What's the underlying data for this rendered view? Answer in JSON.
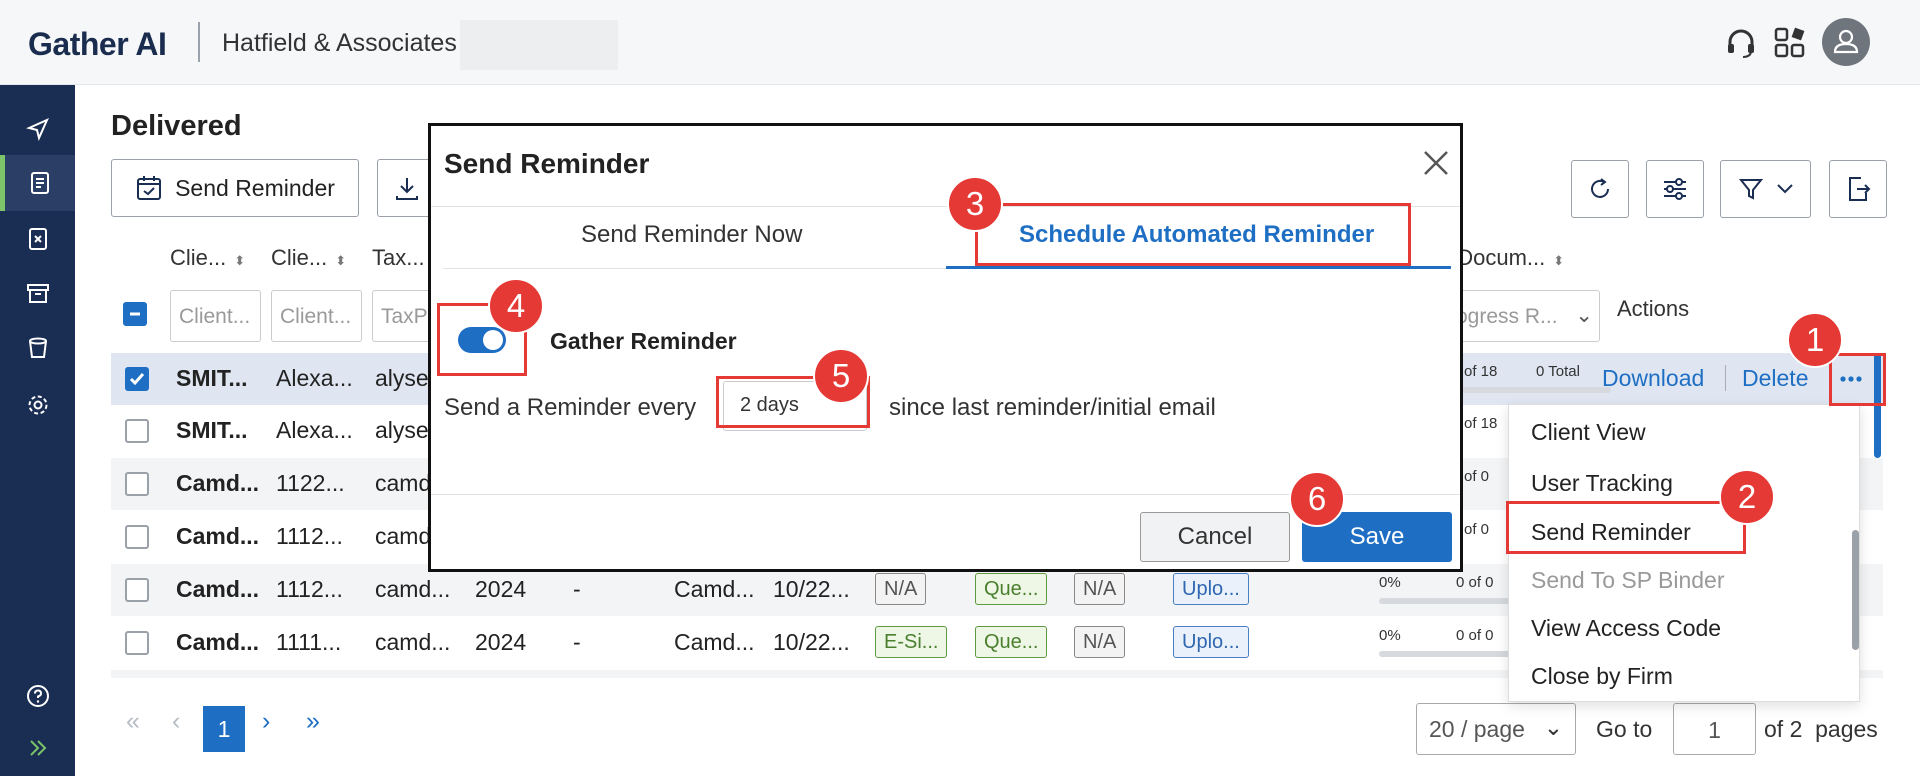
{
  "header": {
    "logo": "Gather AI",
    "firm": "Hatfield & Associates",
    "icons": [
      "headset-icon",
      "apps-icon",
      "user-avatar-icon"
    ]
  },
  "sidebar": {
    "items": [
      "send-icon",
      "document-icon",
      "close-file-icon",
      "archive-icon",
      "trash-icon",
      "settings-icon"
    ],
    "bottom": [
      "help-icon",
      "expand-icon"
    ]
  },
  "page": {
    "title": "Delivered",
    "send_reminder_label": "Send Reminder"
  },
  "table": {
    "headers": [
      "Clie...",
      "Clie...",
      "Tax...",
      "t Docum..."
    ],
    "actions_header": "Actions",
    "filters": [
      "Client...",
      "Client...",
      "TaxP",
      "rogress R..."
    ],
    "rows": [
      {
        "name": "SMIT...",
        "client": "Alexa...",
        "tax": "alyse",
        "progress": "of 18",
        "total": "0 Total",
        "download": "Download",
        "delete": "Delete"
      },
      {
        "name": "SMIT...",
        "client": "Alexa...",
        "tax": "alyse",
        "progress": "of 18"
      },
      {
        "name": "Camd...",
        "client": "1122...",
        "tax": "camd",
        "progress": "of 0"
      },
      {
        "name": "Camd...",
        "client": "1112...",
        "tax": "camd",
        "progress": "of 0"
      },
      {
        "name": "Camd...",
        "client": "1112...",
        "tax": "camd...",
        "year": "2024",
        "dash": "-",
        "col6": "Camd...",
        "date": "10/22...",
        "t1": "N/A",
        "t2": "Que...",
        "t3": "N/A",
        "t4": "Uplo...",
        "pct": "0%",
        "progress": "0 of 0"
      },
      {
        "name": "Camd...",
        "client": "1111...",
        "tax": "camd...",
        "year": "2024",
        "dash": "-",
        "col6": "Camd...",
        "date": "10/22...",
        "t1": "E-Si...",
        "t2": "Que...",
        "t3": "N/A",
        "t4": "Uplo...",
        "pct": "0%",
        "progress": "0 of 0"
      }
    ]
  },
  "menu": {
    "items": [
      "Client View",
      "User Tracking",
      "Send Reminder",
      "Send To SP Binder",
      "View Access Code",
      "Close by Firm"
    ]
  },
  "pagination": {
    "current": "1",
    "per_page": "20 / page",
    "goto_label": "Go to",
    "goto_value": "1",
    "of_pages": "of 2  pages"
  },
  "modal": {
    "title": "Send Reminder",
    "tab_now": "Send Reminder Now",
    "tab_schedule": "Schedule Automated Reminder",
    "toggle_label": "Gather Reminder",
    "toggle_on": true,
    "reminder_prefix": "Send a Reminder every",
    "reminder_value": "2 days",
    "reminder_suffix": "since last reminder/initial email",
    "cancel": "Cancel",
    "save": "Save"
  },
  "annotations": [
    "1",
    "2",
    "3",
    "4",
    "5",
    "6"
  ],
  "colors": {
    "accent": "#1e6fc4",
    "sidebar": "#1a2d52",
    "annotation": "#e53935",
    "active_marker": "#7cc36a"
  }
}
